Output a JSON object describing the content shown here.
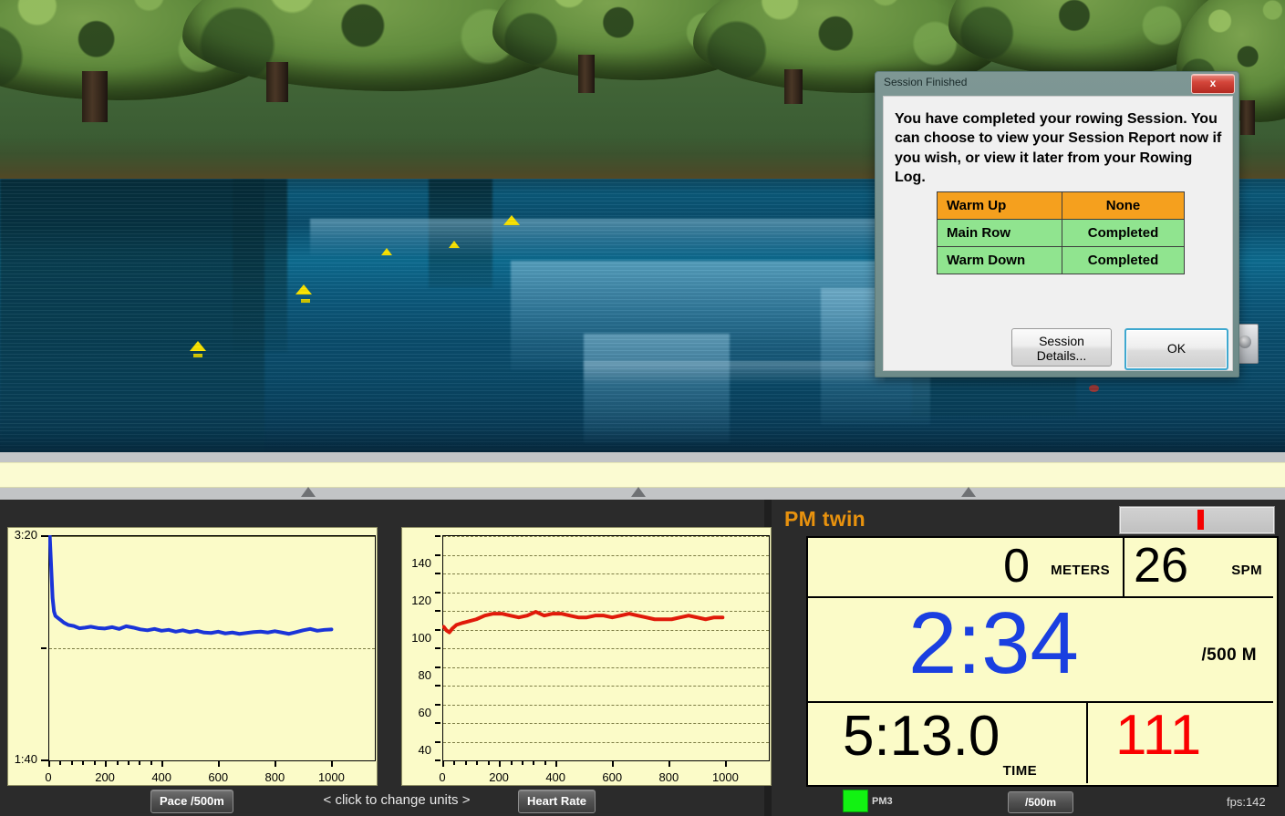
{
  "app": {
    "scene_name": "rowing-simulator-3d-scene"
  },
  "race_strip": {
    "markers": [
      338,
      700,
      1062
    ]
  },
  "dialog": {
    "title": "Session Finished",
    "close_label": "x",
    "message": "You have completed your rowing Session.  You can choose to view your Session Report now if you wish, or view it later from your Rowing Log.",
    "table": {
      "rows": [
        {
          "label": "Warm Up",
          "value": "None",
          "color": "#f5a01e"
        },
        {
          "label": "Main Row",
          "value": "Completed",
          "color": "#90e48f"
        },
        {
          "label": "Warm Down",
          "value": "Completed",
          "color": "#90e48f"
        }
      ]
    },
    "buttons": {
      "session_details": "Session Details...",
      "ok": "OK"
    }
  },
  "charts": {
    "pace_button": "Pace /500m",
    "hr_button": "Heart Rate",
    "hint": "<  click to change units  >"
  },
  "pm": {
    "title": "PM twin",
    "distance_value": "0",
    "distance_unit": "METERS",
    "rate_value": "26",
    "rate_unit": "SPM",
    "pace_value": "2:34",
    "pace_unit": "/500 M",
    "time_value": "5:13.0",
    "time_unit": "TIME",
    "hr_value": "111",
    "led_label": "PM3",
    "unit_button": "/500m",
    "fps": "fps:142",
    "accent_title": "#e8920e",
    "accent_pace": "#1a3fe0",
    "accent_hr": "#fa0000",
    "panel_bg": "#fbfbc8"
  },
  "chart_data": [
    {
      "id": "pace",
      "type": "line",
      "title": "Pace /500m",
      "xlabel": "",
      "ylabel": "",
      "color": "#1a34d8",
      "xlim": [
        0,
        1150
      ],
      "ylim_label_top": "1:40",
      "ylim_label_bottom": "3:20",
      "ytick_labels": [
        "1:40",
        "3:20"
      ],
      "ytick_values": [
        100,
        200
      ],
      "ylim": [
        100,
        200
      ],
      "y_inverted": false,
      "xticks": [
        0,
        200,
        400,
        600,
        800,
        1000
      ],
      "xtick_labels": [
        "0",
        "200",
        "400",
        "600",
        "800",
        "1000"
      ],
      "grid": true,
      "x": [
        5,
        10,
        15,
        20,
        25,
        35,
        45,
        55,
        70,
        90,
        110,
        130,
        150,
        175,
        200,
        225,
        250,
        275,
        300,
        325,
        350,
        375,
        400,
        425,
        450,
        475,
        500,
        525,
        550,
        575,
        600,
        625,
        650,
        675,
        700,
        725,
        750,
        775,
        800,
        825,
        850,
        875,
        900,
        925,
        950,
        975,
        1000
      ],
      "y": [
        200,
        186,
        172,
        166,
        164,
        163,
        162,
        161,
        160,
        159.5,
        158.5,
        158.8,
        159.2,
        158.6,
        158.4,
        159.0,
        158.2,
        159.4,
        158.8,
        158.0,
        157.6,
        158.2,
        157.4,
        157.8,
        157.0,
        157.6,
        156.8,
        157.4,
        156.6,
        156.4,
        157.0,
        156.2,
        156.6,
        156.0,
        156.4,
        156.8,
        157.0,
        156.6,
        157.2,
        156.6,
        156.0,
        156.8,
        157.6,
        158.2,
        157.4,
        157.8,
        158.0
      ]
    },
    {
      "id": "heart_rate",
      "type": "line",
      "title": "Heart Rate",
      "xlabel": "",
      "ylabel": "",
      "color": "#e01a0a",
      "xlim": [
        0,
        1150
      ],
      "ylim": [
        35,
        155
      ],
      "yticks": [
        40,
        60,
        80,
        100,
        120,
        140
      ],
      "ytick_labels": [
        "40",
        "60",
        "80",
        "100",
        "120",
        "140"
      ],
      "xticks": [
        0,
        200,
        400,
        600,
        800,
        1000
      ],
      "xtick_labels": [
        "0",
        "200",
        "400",
        "600",
        "800",
        "1000"
      ],
      "grid": true,
      "x": [
        5,
        15,
        25,
        35,
        50,
        70,
        95,
        120,
        150,
        180,
        210,
        240,
        270,
        300,
        330,
        360,
        390,
        420,
        450,
        480,
        510,
        540,
        570,
        600,
        630,
        660,
        690,
        720,
        750,
        780,
        810,
        840,
        870,
        900,
        930,
        960,
        990
      ],
      "y": [
        106,
        104,
        103,
        105,
        107,
        108,
        109,
        110,
        112,
        113,
        113,
        112,
        111,
        112,
        114,
        112,
        113,
        113,
        112,
        111,
        111,
        112,
        112,
        111,
        112,
        113,
        112,
        111,
        110,
        110,
        110,
        111,
        112,
        111,
        110,
        111,
        111
      ]
    }
  ]
}
